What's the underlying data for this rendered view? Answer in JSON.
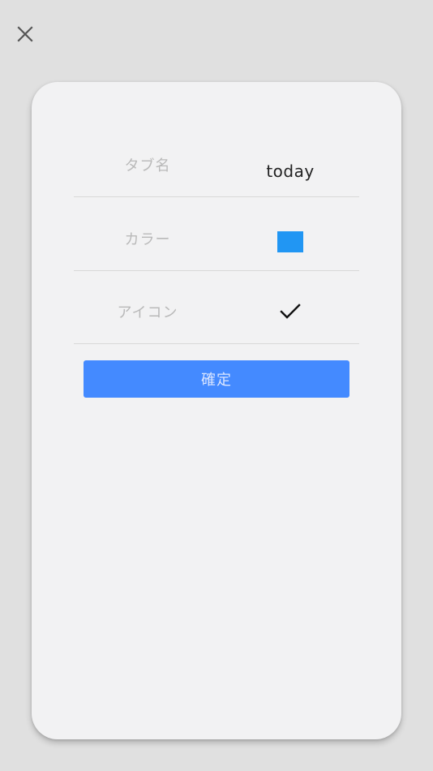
{
  "close_icon": "close-icon",
  "form": {
    "tab_name": {
      "label": "タブ名",
      "value": "today"
    },
    "color": {
      "label": "カラー",
      "value": "#2196F3"
    },
    "icon": {
      "label": "アイコン",
      "value": "check-icon"
    }
  },
  "confirm_button": {
    "label": "確定",
    "color": "#448AFF"
  }
}
